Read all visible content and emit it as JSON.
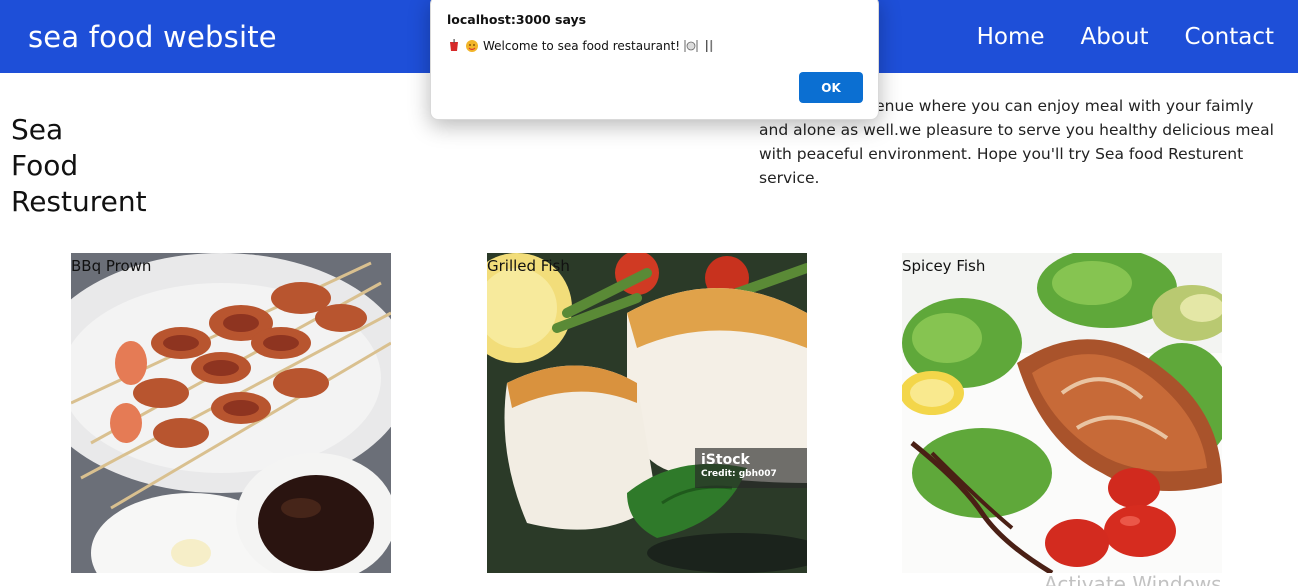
{
  "header": {
    "brand": "sea food website",
    "nav": [
      "Home",
      "About",
      "Contact"
    ]
  },
  "hero": {
    "title": [
      "Sea",
      "Food",
      "Resturent"
    ],
    "description_visible": "nt is the best venue where you can enjoy meal with your faimly and alone as well.we pleasure to serve you healthy delicious meal with peaceful environment. Hope you'll try Sea food Resturent service."
  },
  "cards": [
    {
      "label": "BBq Prown",
      "image_icon": "bbq-prawn-skewers-image"
    },
    {
      "label": "Grilled Fish",
      "image_icon": "grilled-fish-image",
      "badge": {
        "brand": "iStock",
        "credit": "Credit: gbh007"
      }
    },
    {
      "label": "Spicey Fish",
      "image_icon": "spicy-salmon-salad-image"
    }
  ],
  "dialog": {
    "title": "localhost:3000 says",
    "message": "Welcome to sea food restaurant!",
    "ok_label": "OK"
  },
  "watermark": "Activate Windows",
  "colors": {
    "navbar": "#1e4fd8",
    "ok_button": "#0b6fd2"
  }
}
